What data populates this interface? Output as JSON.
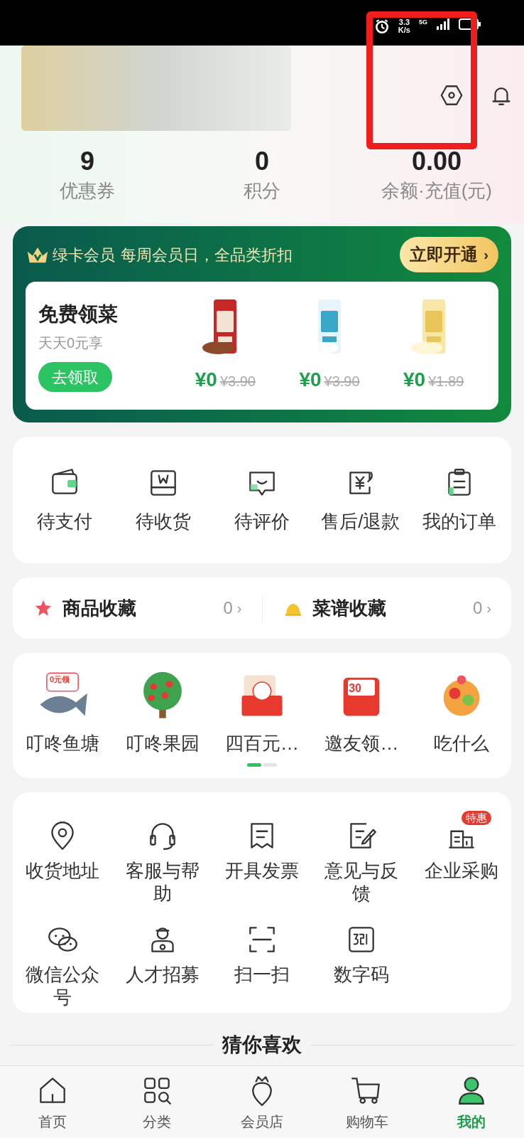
{
  "status_bar": {
    "speed": "3.3\nK/s",
    "network": "5G"
  },
  "stats": [
    {
      "value": "9",
      "label": "优惠券"
    },
    {
      "value": "0",
      "label": "积分"
    },
    {
      "value": "0.00",
      "label": "余额·充值(元)"
    }
  ],
  "membership": {
    "title": "绿卡会员",
    "slogan": "每周会员日，全品类折扣",
    "button": "立即开通",
    "button_arrow": "›",
    "promo": {
      "title": "免费领菜",
      "subtitle": "天天0元享",
      "button": "去领取"
    },
    "products": [
      {
        "price": "¥0",
        "original_price": "¥3.90"
      },
      {
        "price": "¥0",
        "original_price": "¥3.90"
      },
      {
        "price": "¥0",
        "original_price": "¥1.89"
      }
    ]
  },
  "orders": [
    {
      "label": "待支付"
    },
    {
      "label": "待收货"
    },
    {
      "label": "待评价"
    },
    {
      "label": "售后/退款"
    },
    {
      "label": "我的订单"
    }
  ],
  "favorites": [
    {
      "label": "商品收藏",
      "count": "0",
      "arrow": "›"
    },
    {
      "label": "菜谱收藏",
      "count": "0",
      "arrow": "›"
    }
  ],
  "activities": {
    "items": [
      {
        "label": "叮咚鱼塘",
        "badge": "0元领"
      },
      {
        "label": "叮咚果园"
      },
      {
        "label": "四百元…"
      },
      {
        "label": "邀友领…",
        "badge": "30"
      },
      {
        "label": "吃什么"
      }
    ],
    "pages": [
      {
        "selected": true
      },
      {
        "selected": false
      }
    ]
  },
  "services": [
    {
      "label": "收货地址"
    },
    {
      "label": "客服与帮助"
    },
    {
      "label": "开具发票"
    },
    {
      "label": "意见与反馈"
    },
    {
      "label": "企业采购",
      "badge": "特惠"
    },
    {
      "label": "微信公众号"
    },
    {
      "label": "人才招募"
    },
    {
      "label": "扫一扫"
    },
    {
      "label": "数字码"
    }
  ],
  "section_title": "猜你喜欢",
  "nav": [
    {
      "label": "首页",
      "selected": false
    },
    {
      "label": "分类",
      "selected": false
    },
    {
      "label": "会员店",
      "selected": false
    },
    {
      "label": "购物车",
      "selected": false
    },
    {
      "label": "我的",
      "selected": true
    }
  ]
}
